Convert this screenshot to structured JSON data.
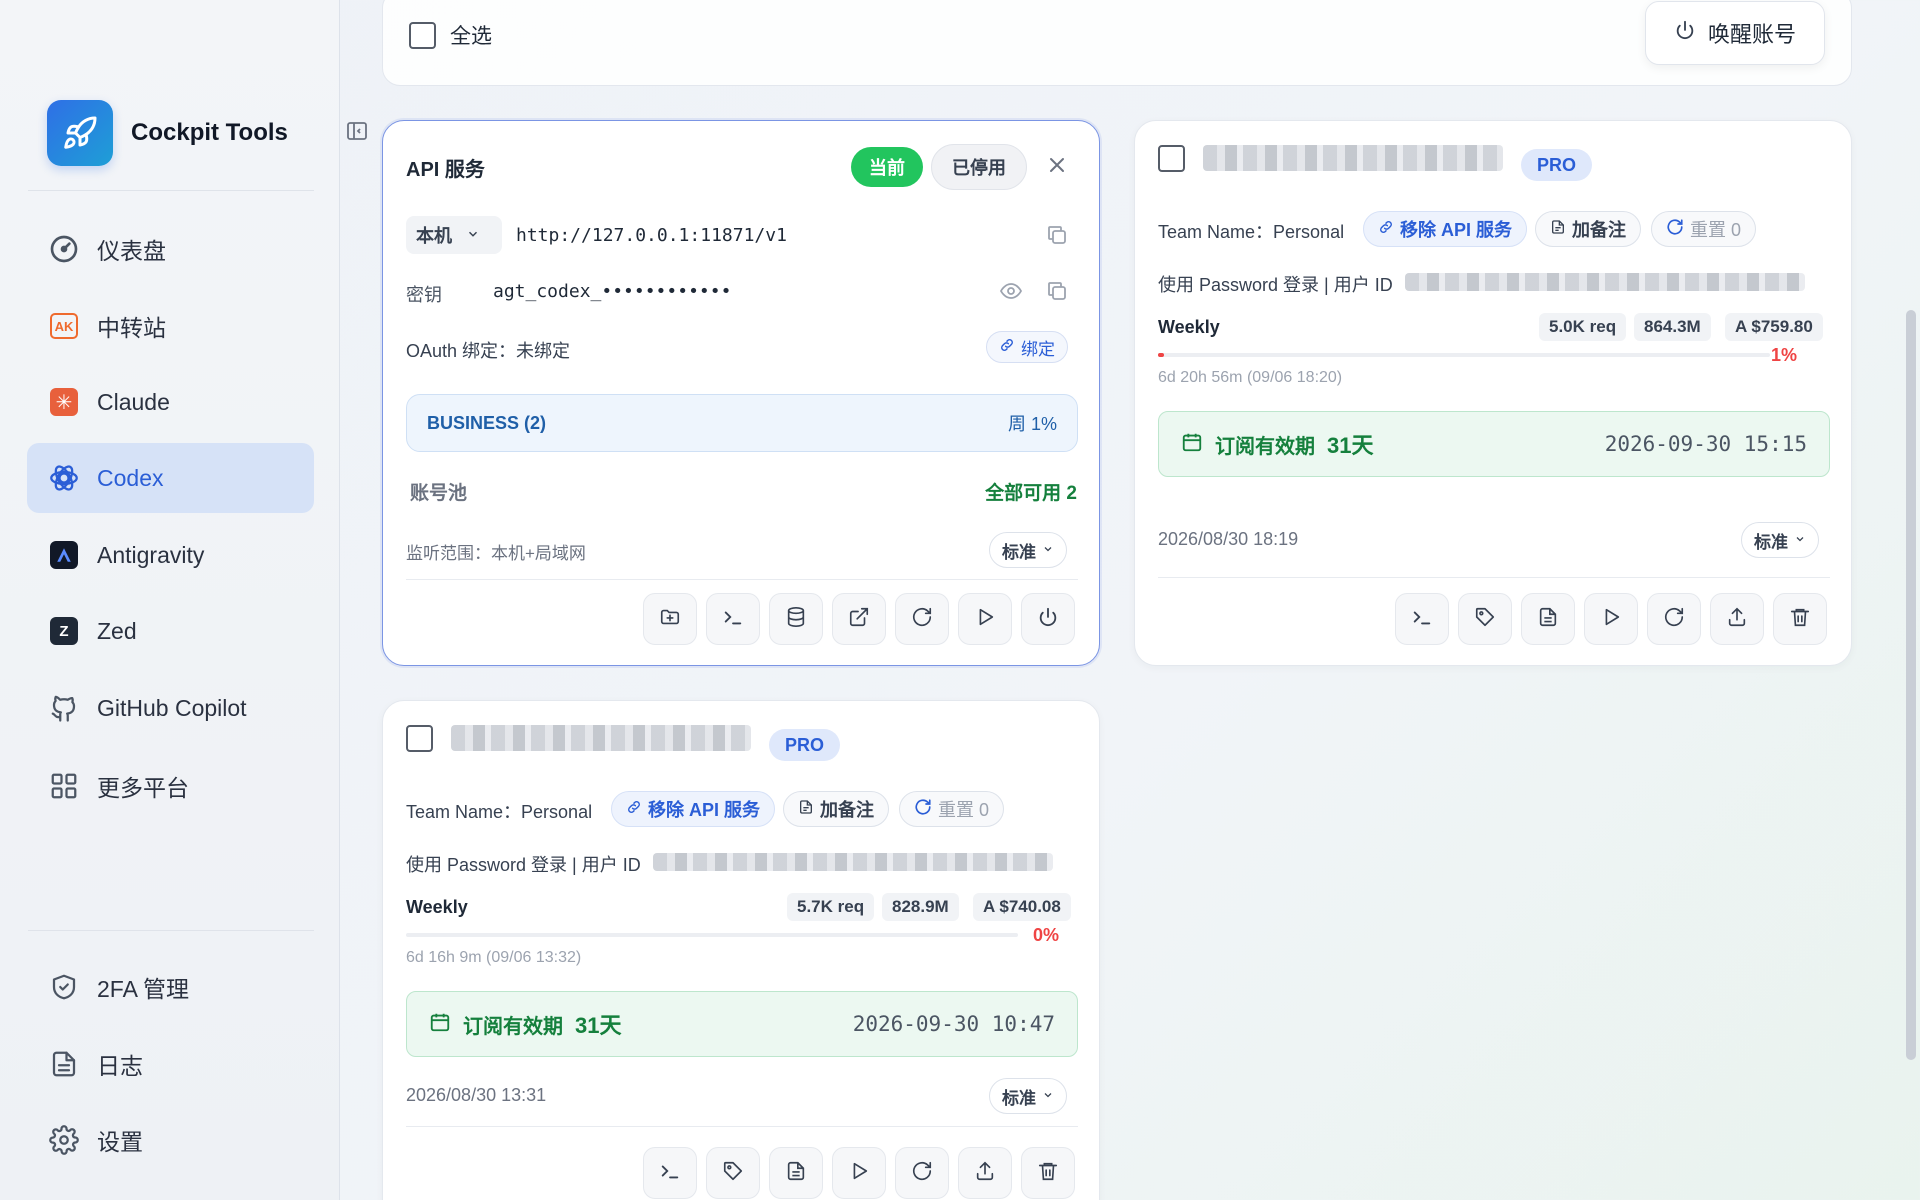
{
  "brand": {
    "name": "Cockpit Tools"
  },
  "nav": {
    "items": [
      {
        "label": "仪表盘",
        "icon": "gauge-icon"
      },
      {
        "label": "中转站",
        "icon": "ak-relay-icon",
        "badge": "AK"
      },
      {
        "label": "Claude",
        "icon": "claude-icon"
      },
      {
        "label": "Codex",
        "icon": "openai-icon",
        "active": true
      },
      {
        "label": "Antigravity",
        "icon": "antigravity-icon"
      },
      {
        "label": "Zed",
        "icon": "zed-icon"
      },
      {
        "label": "GitHub Copilot",
        "icon": "github-copilot-icon"
      },
      {
        "label": "更多平台",
        "icon": "grid-icon"
      }
    ],
    "bottom": [
      {
        "label": "2FA 管理",
        "icon": "shield-check-icon"
      },
      {
        "label": "日志",
        "icon": "document-icon"
      },
      {
        "label": "设置",
        "icon": "gear-icon"
      }
    ]
  },
  "toolbar": {
    "select_all": "全选",
    "wake_label": "唤醒账号"
  },
  "api_card": {
    "title": "API 服务",
    "current_badge": "当前",
    "disabled_badge": "已停用",
    "host_select": "本机",
    "url": "http://127.0.0.1:11871/v1",
    "key_label": "密钥",
    "key_value": "agt_codex_••••••••••••",
    "oauth_text": "OAuth 绑定：未绑定",
    "bind_label": "绑定",
    "business_label": "BUSINESS (2)",
    "business_usage": "周 1%",
    "pool_label": "账号池",
    "pool_status": "全部可用 2",
    "listen_text": "监听范围：本机+局域网",
    "mode_select": "标准"
  },
  "accounts": [
    {
      "plan": "PRO",
      "team": "Team Name：Personal",
      "remove_api": "移除 API 服务",
      "add_note": "加备注",
      "reset": "重置 0",
      "login": "使用 Password 登录 | 用户 ID",
      "weekly": "Weekly",
      "req": "5.0K req",
      "tokens": "864.3M",
      "cost": "A $759.80",
      "percent": "1%",
      "percent_value": 1,
      "reset_time": "6d 20h 56m (09/06 18:20)",
      "sub_label": "订阅有效期",
      "sub_days": "31天",
      "sub_date": "2026-09-30 15:15",
      "created": "2026/08/30 18:19",
      "mode": "标准"
    },
    {
      "plan": "PRO",
      "team": "Team Name：Personal",
      "remove_api": "移除 API 服务",
      "add_note": "加备注",
      "reset": "重置 0",
      "login": "使用 Password 登录 | 用户 ID",
      "weekly": "Weekly",
      "req": "5.7K req",
      "tokens": "828.9M",
      "cost": "A $740.08",
      "percent": "0%",
      "percent_value": 0,
      "reset_time": "6d 16h 9m (09/06 13:32)",
      "sub_label": "订阅有效期",
      "sub_days": "31天",
      "sub_date": "2026-09-30 10:47",
      "created": "2026/08/30 13:31",
      "mode": "标准"
    }
  ],
  "colors": {
    "accent": "#2b5ed6",
    "success": "#22c55e",
    "danger": "#ef4444",
    "active_nav_bg": "#d6e2f7"
  }
}
